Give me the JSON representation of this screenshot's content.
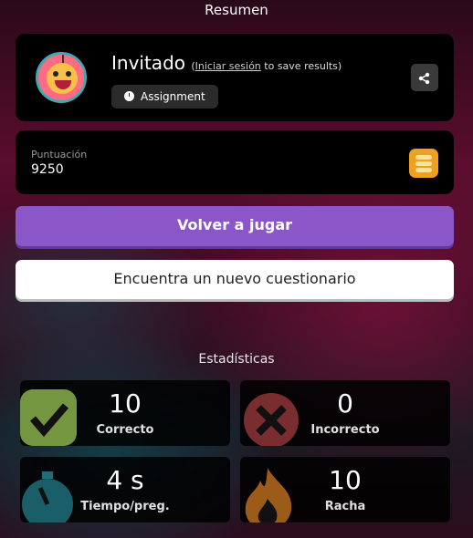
{
  "header": {
    "title": "Resumen"
  },
  "player": {
    "name": "Invitado",
    "login_link": "Iniciar sesión",
    "login_suffix": "to save results",
    "badge": "Assignment",
    "share_icon": "share-icon"
  },
  "score": {
    "label": "Puntuación",
    "value": "9250",
    "icon": "coins-icon"
  },
  "buttons": {
    "play_again": "Volver a jugar",
    "new_quiz": "Encuentra un nuevo cuestionario"
  },
  "stats": {
    "title": "Estadísticas",
    "items": [
      {
        "value": "10",
        "label": "Correcto",
        "icon": "check-icon",
        "color": "#8ab04a"
      },
      {
        "value": "0",
        "label": "Incorrecto",
        "icon": "cross-icon",
        "color": "#c84a4a"
      },
      {
        "value": "4 s",
        "label": "Tiempo/preg.",
        "icon": "stopwatch-icon",
        "color": "#2aa0b0"
      },
      {
        "value": "10",
        "label": "Racha",
        "icon": "flame-icon",
        "color": "#d07a20"
      }
    ]
  }
}
